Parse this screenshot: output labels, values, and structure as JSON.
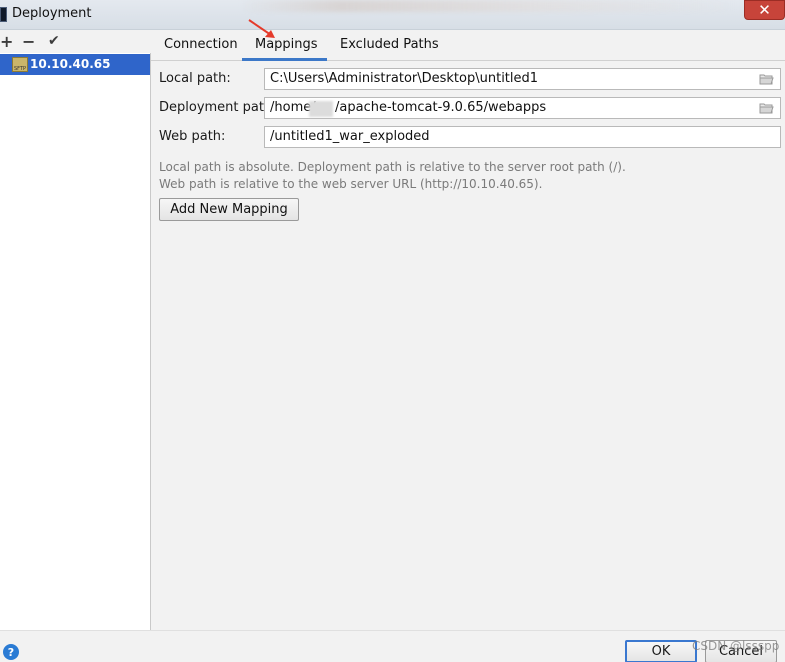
{
  "window": {
    "title": "Deployment",
    "close_label": "✕"
  },
  "toolbar": {
    "add_icon": "+",
    "remove_icon": "−",
    "check_icon": "✔"
  },
  "servers": [
    {
      "label": "10.10.40.65",
      "icon": "sftp-server-icon",
      "selected": true
    }
  ],
  "tabs": [
    {
      "label": "Connection",
      "active": false
    },
    {
      "label": "Mappings",
      "active": true
    },
    {
      "label": "Excluded Paths",
      "active": false
    }
  ],
  "form": {
    "local_path_label": "Local path:",
    "local_path_value": "C:\\Users\\Administrator\\Desktop\\untitled1",
    "deployment_path_label": "Deployment path:",
    "deployment_path_prefix": "/home/",
    "deployment_path_suffix": "/apache-tomcat-9.0.65/webapps",
    "web_path_label": "Web path:",
    "web_path_value": "/untitled1_war_exploded"
  },
  "hints": {
    "line1": "Local path is absolute. Deployment path is relative to the server root path (/).",
    "line2": "Web path is relative to the web server URL (http://10.10.40.65)."
  },
  "buttons": {
    "add_mapping": "Add New Mapping",
    "ok": "OK",
    "cancel": "Cancel",
    "help": "?"
  },
  "watermark": "CSDN @lssspp",
  "colors": {
    "selection": "#2f65ca",
    "tab_underline": "#3c78c8",
    "close_button": "#c7443a",
    "arrow": "#e53a2a"
  }
}
